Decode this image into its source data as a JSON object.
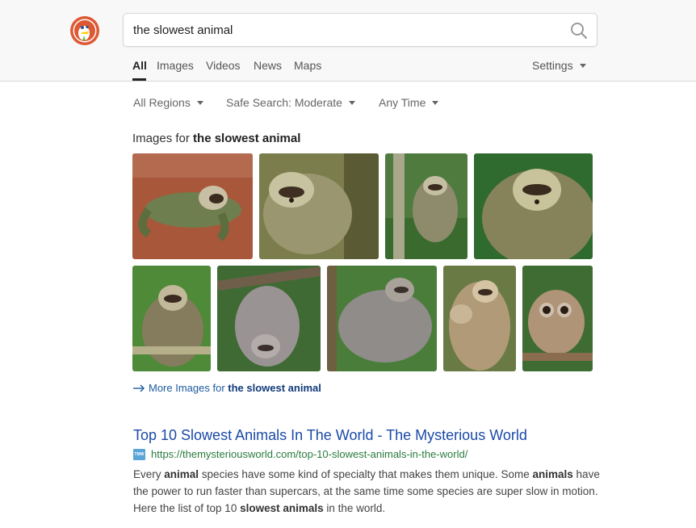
{
  "search": {
    "query": "the slowest animal"
  },
  "nav": {
    "tabs": [
      {
        "label": "All",
        "active": true
      },
      {
        "label": "Images"
      },
      {
        "label": "Videos"
      },
      {
        "label": "News"
      },
      {
        "label": "Maps"
      }
    ],
    "settings_label": "Settings"
  },
  "filters": {
    "region": "All Regions",
    "safe_search": "Safe Search: Moderate",
    "time": "Any Time"
  },
  "images": {
    "heading_prefix": "Images for ",
    "heading_query": "the slowest animal",
    "more_prefix": "More Images for ",
    "more_query": "the slowest animal",
    "tiles": [
      {
        "subject": "sloth on dirt"
      },
      {
        "subject": "sloth face"
      },
      {
        "subject": "sloth in tree"
      },
      {
        "subject": "sloth close-up"
      },
      {
        "subject": "sloth on branch"
      },
      {
        "subject": "hanging sloth"
      },
      {
        "subject": "sloth climbing"
      },
      {
        "subject": "mother and baby sloth"
      },
      {
        "subject": "slow loris"
      }
    ]
  },
  "result": {
    "title": "Top 10 Slowest Animals In The World - The Mysterious World",
    "url": "https://themysteriousworld.com/top-10-slowest-animals-in-the-world/",
    "favicon_text": "TMW",
    "snippet": [
      {
        "text": "Every "
      },
      {
        "text": "animal",
        "bold": true
      },
      {
        "text": " species have some kind of specialty that makes them unique. Some "
      },
      {
        "text": "animals",
        "bold": true
      },
      {
        "text": " have the power to run faster than supercars, at the same time some species are super slow in motion. Here the list of top 10 "
      },
      {
        "text": "slowest animals",
        "bold": true
      },
      {
        "text": " in the world."
      }
    ]
  },
  "colors": {
    "link": "#1a4aa8",
    "url": "#2a7b3e",
    "logo": "#de5833"
  }
}
